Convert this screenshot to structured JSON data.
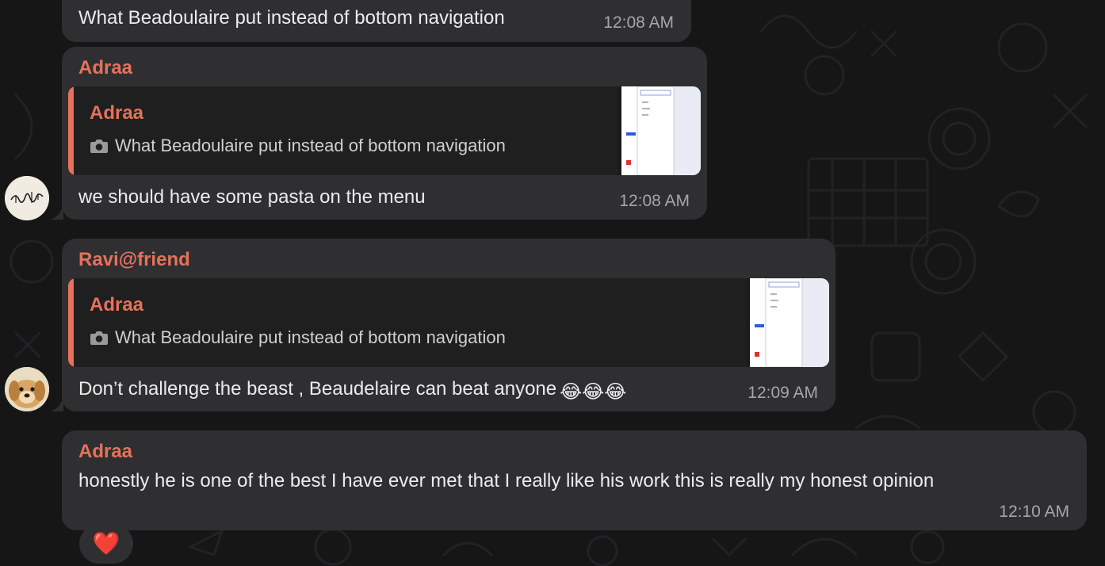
{
  "colors": {
    "accent": "#e7715b",
    "bubble": "#2f2f31",
    "background": "#161616"
  },
  "messages": [
    {
      "text": "What Beadoulaire put instead of bottom navigation",
      "time": "12:08 AM"
    },
    {
      "sender": "Adraa",
      "reply": {
        "sender": "Adraa",
        "text": "What Beadoulaire put instead of bottom navigation",
        "icon": "camera-icon"
      },
      "text": "we should have some pasta on the menu",
      "time": "12:08 AM"
    },
    {
      "sender": "Ravi@friend",
      "reply": {
        "sender": "Adraa",
        "text": "What Beadoulaire put instead of bottom navigation",
        "icon": "camera-icon"
      },
      "text": "Don’t challenge the beast , Beaudelaire can beat anyone",
      "emojis": "😂😂😂",
      "time": "12:09 AM"
    },
    {
      "sender": "Adraa",
      "text": "honestly he is one of the best I have ever met that I really like his work this is really my honest opinion",
      "time": "12:10 AM",
      "reaction": "❤️"
    }
  ]
}
